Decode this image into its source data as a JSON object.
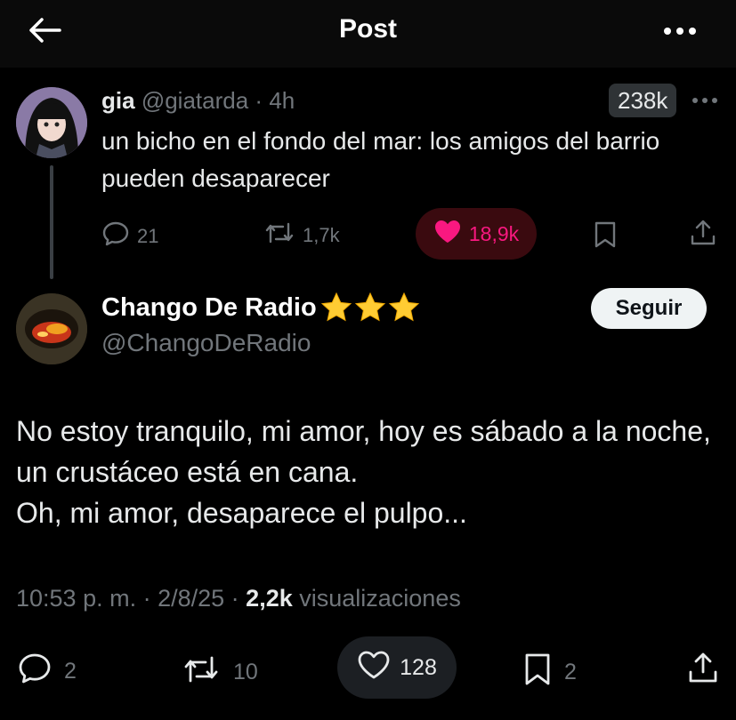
{
  "header": {
    "title": "Post"
  },
  "parent": {
    "name": "gia",
    "handle": "@giatarda",
    "separator": "·",
    "time": "4h",
    "views_badge": "238k",
    "text": "un bicho en el fondo del mar: los amigos del barrio pueden desaparecer",
    "replies": "21",
    "reposts": "1,7k",
    "likes": "18,9k",
    "colors": {
      "like": "#f91880",
      "like_bg": "#3a0a0f"
    }
  },
  "main": {
    "name": "Chango De Radio",
    "badges": [
      "star-icon",
      "star-icon",
      "star-icon"
    ],
    "handle": "@ChangoDeRadio",
    "follow_label": "Seguir",
    "text_lines": [
      "No estoy tranquilo, mi amor, hoy es sábado a la noche, un crustáceo está en cana.",
      "Oh, mi amor, desaparece el pulpo..."
    ],
    "time": "10:53 p. m.",
    "date": "2/8/25",
    "views_count": "2,2k",
    "views_label": "visualizaciones",
    "replies": "2",
    "reposts": "10",
    "likes": "128",
    "bookmarks": "2"
  }
}
